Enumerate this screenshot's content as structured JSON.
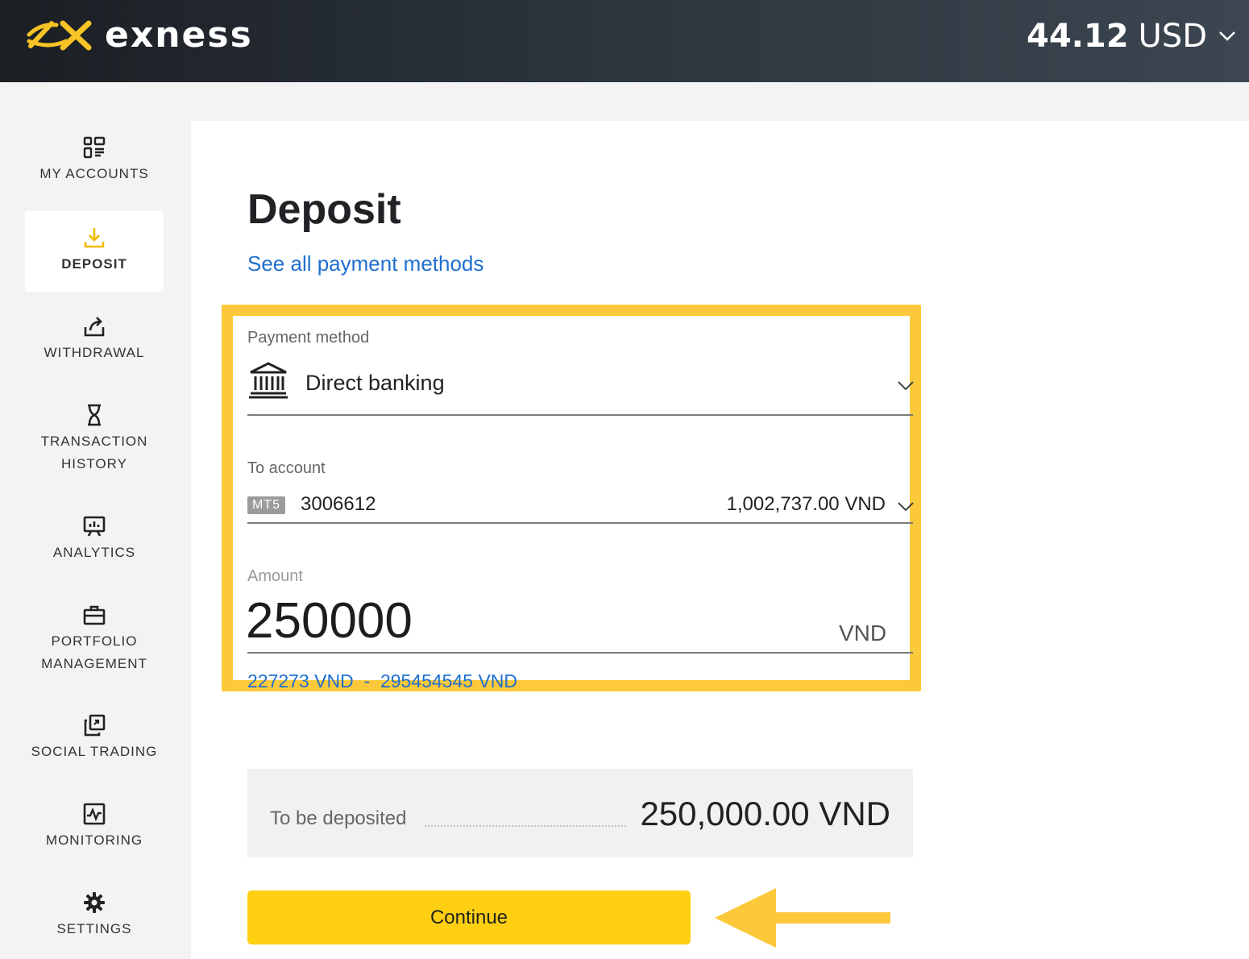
{
  "header": {
    "brand": "exness",
    "balance_amount": "44.12",
    "balance_currency": "USD"
  },
  "sidebar": {
    "items": [
      {
        "label": "MY ACCOUNTS",
        "icon": "grid-list-icon",
        "active": false
      },
      {
        "label": "DEPOSIT",
        "icon": "download-tray-icon",
        "active": true
      },
      {
        "label": "WITHDRAWAL",
        "icon": "upload-share-icon",
        "active": false
      },
      {
        "label_line1": "TRANSACTION",
        "label_line2": "HISTORY",
        "icon": "hourglass-icon",
        "active": false
      },
      {
        "label": "ANALYTICS",
        "icon": "presentation-chart-icon",
        "active": false
      },
      {
        "label_line1": "PORTFOLIO",
        "label_line2": "MANAGEMENT",
        "icon": "briefcase-icon",
        "active": false
      },
      {
        "label": "SOCIAL TRADING",
        "icon": "copy-squares-icon",
        "active": false
      },
      {
        "label": "MONITORING",
        "icon": "pulse-chart-icon",
        "active": false
      },
      {
        "label": "SETTINGS",
        "icon": "gear-icon",
        "active": false
      }
    ]
  },
  "main": {
    "title": "Deposit",
    "see_all_link": "See all payment methods",
    "payment_method": {
      "label": "Payment method",
      "value": "Direct banking"
    },
    "to_account": {
      "label": "To account",
      "badge": "MT5",
      "number": "3006612",
      "balance": "1,002,737.00 VND"
    },
    "amount": {
      "label": "Amount",
      "value": "250000",
      "currency": "VND",
      "min": "227273 VND",
      "separator": "-",
      "max": "295454545 VND"
    },
    "summary": {
      "label": "To be deposited",
      "value": "250,000.00 VND"
    },
    "continue_label": "Continue"
  },
  "colors": {
    "accent_yellow": "#ffcf12",
    "highlight_border": "#fcc93a",
    "link_blue": "#1f6fcf",
    "header_dark": "#2f3740"
  }
}
